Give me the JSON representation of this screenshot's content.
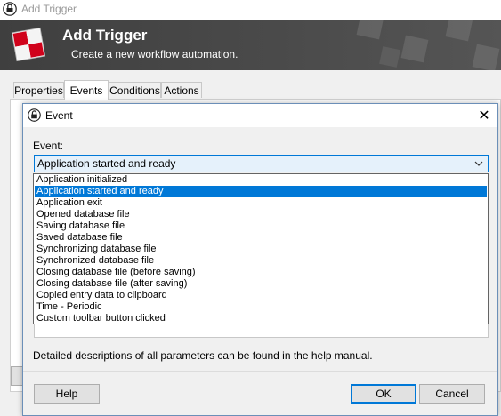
{
  "outer_window": {
    "title": "Add Trigger"
  },
  "banner": {
    "title": "Add Trigger",
    "subtitle": "Create a new workflow automation."
  },
  "tabs": [
    {
      "label": "Properties"
    },
    {
      "label": "Events"
    },
    {
      "label": "Conditions"
    },
    {
      "label": "Actions"
    }
  ],
  "active_tab": "Events",
  "dialog": {
    "title": "Event",
    "close_glyph": "✕",
    "event_label": "Event:",
    "selected_event": "Application started and ready",
    "help_text": "Detailed descriptions of all parameters can be found in the help manual.",
    "buttons": {
      "help": "Help",
      "ok": "OK",
      "cancel": "Cancel"
    }
  },
  "dropdown": {
    "options": [
      "Application initialized",
      "Application started and ready",
      "Application exit",
      "Opened database file",
      "Saving database file",
      "Saved database file",
      "Synchronizing database file",
      "Synchronized database file",
      "Closing database file (before saving)",
      "Closing database file (after saving)",
      "Copied entry data to clipboard",
      "Time - Periodic",
      "Custom toolbar button clicked"
    ],
    "highlighted_index": 1
  },
  "colors": {
    "accent": "#0078d7",
    "banner_bg": "#454545",
    "selection": "#0078d7"
  },
  "icons": [
    "lock-icon",
    "app-logo-icon",
    "close-icon",
    "chevron-down-icon"
  ]
}
